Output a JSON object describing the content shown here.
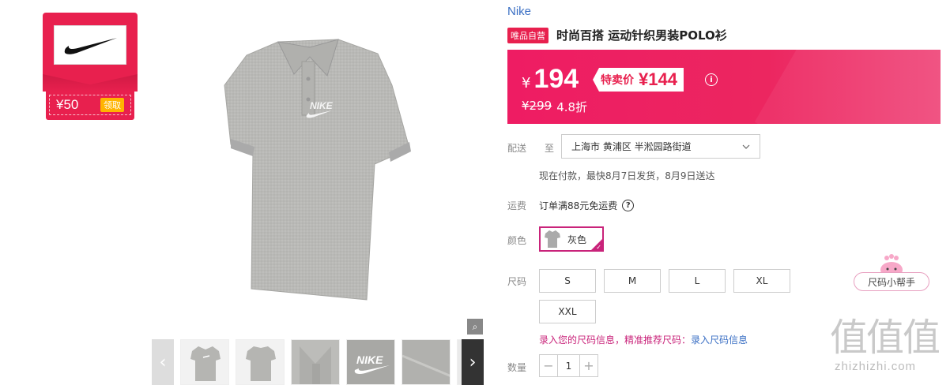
{
  "coupon": {
    "amount": "¥50",
    "action": "领取",
    "brand_color": "#e8204e"
  },
  "product": {
    "brand": "Nike",
    "self_operated_badge": "唯品自营",
    "title": "时尚百搭 运动针织男装POLO衫",
    "image_icon": "polo-shirt-image",
    "zoom_icon": "magnifier-icon"
  },
  "thumbnails": {
    "prev_icon": "chevron-left-icon",
    "next_icon": "chevron-right-icon",
    "items": [
      "front-view",
      "back-view",
      "collar-detail",
      "logo-detail",
      "fabric-detail",
      "tag-detail"
    ]
  },
  "price": {
    "currency": "¥",
    "current": "194",
    "special_label": "特卖价",
    "special_value": "¥144",
    "original": "¥299",
    "discount": "4.8折",
    "panel_color": "#ee1c63"
  },
  "delivery": {
    "label": "配送",
    "to_label": "至",
    "address": "上海市 黄浦区 半淞园路街道",
    "note": "现在付款，最快8月7日发货，8月9日送达"
  },
  "freight": {
    "label": "运费",
    "text": "订单满88元免运费",
    "help": "?"
  },
  "color": {
    "label": "颜色",
    "selected": "灰色",
    "accent": "#c9237a"
  },
  "size": {
    "label": "尺码",
    "options": [
      "S",
      "M",
      "L",
      "XL",
      "XXL"
    ],
    "helper": "尺码小帮手",
    "info_text": "录入您的尺码信息，精准推荐尺码：",
    "info_link": "录入尺码信息"
  },
  "quantity": {
    "label": "数量",
    "minus": "−",
    "value": "1",
    "plus": "+"
  },
  "watermark": {
    "glyphs": "值值值",
    "site": "zhizhizhi.com"
  }
}
